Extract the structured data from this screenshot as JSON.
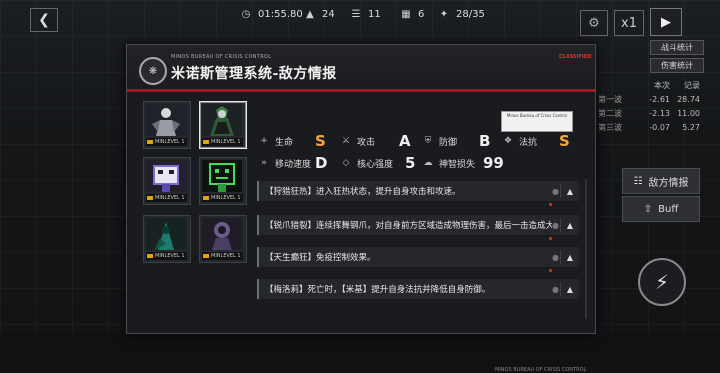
{
  "hud": {
    "back_icon": "chevron-left-icon",
    "timer": "01:55.80",
    "kills": "24",
    "enemies": "11",
    "cost": "6",
    "wave": "28/35",
    "speed": "x1",
    "play_icon": "play-icon"
  },
  "side": {
    "tab1": "战斗统计",
    "tab2": "伤害统计",
    "col_this": "本次",
    "col_record": "记录",
    "rows": [
      {
        "label": "第一波",
        "this": "-2.61",
        "record": "28.74"
      },
      {
        "label": "第二波",
        "this": "-2.13",
        "record": "11.00"
      },
      {
        "label": "第三波",
        "this": "-0.07",
        "record": "5.27"
      }
    ],
    "enemy_info_btn": "敌方情报",
    "buff_btn": "Buff"
  },
  "modal": {
    "org": "MINOS BUREAU OF CRISIS CONTROL",
    "title": "米诺斯管理系统-敌方情报",
    "tag": "CLASSIFIED",
    "desc_label": "Minos Bureau of Crisis Control",
    "enemies": [
      {
        "name": "enemy-1",
        "level": "MINLEVEL 1",
        "selected": false
      },
      {
        "name": "enemy-2",
        "level": "MINLEVEL 1",
        "selected": true
      },
      {
        "name": "enemy-3",
        "level": "MINLEVEL 1",
        "selected": false
      },
      {
        "name": "enemy-4",
        "level": "MINLEVEL 1",
        "selected": false
      },
      {
        "name": "enemy-5",
        "level": "MINLEVEL 1",
        "selected": false
      },
      {
        "name": "enemy-6",
        "level": "MINLEVEL 1",
        "selected": false
      }
    ],
    "stats": {
      "hp_label": "生命",
      "hp_value": "S",
      "atk_label": "攻击",
      "atk_value": "A",
      "def_label": "防御",
      "def_value": "B",
      "res_label": "法抗",
      "res_value": "S",
      "spd_label": "移动速度",
      "spd_value": "D",
      "core_label": "核心强度",
      "core_value": "5",
      "sanity_label": "神智损失",
      "sanity_value": "99"
    },
    "abilities": [
      "【狩猎狂热】进入狂热状态，提升自身攻击和攻速。",
      "【锐爪猎裂】连续挥舞钢爪，对自身前方区域造成物理伤害，最后一击造成大...",
      "【天生癫狂】免疫控制效果。",
      "【梅洛莉】死亡时，【米基】提升自身法抗并降低自身防御。"
    ],
    "footer_tag": "MINOS BUREAU OF CRISIS CONTROL"
  },
  "colors": {
    "accent_red": "#9a1c22",
    "grade_gold": "#f3a73a"
  }
}
